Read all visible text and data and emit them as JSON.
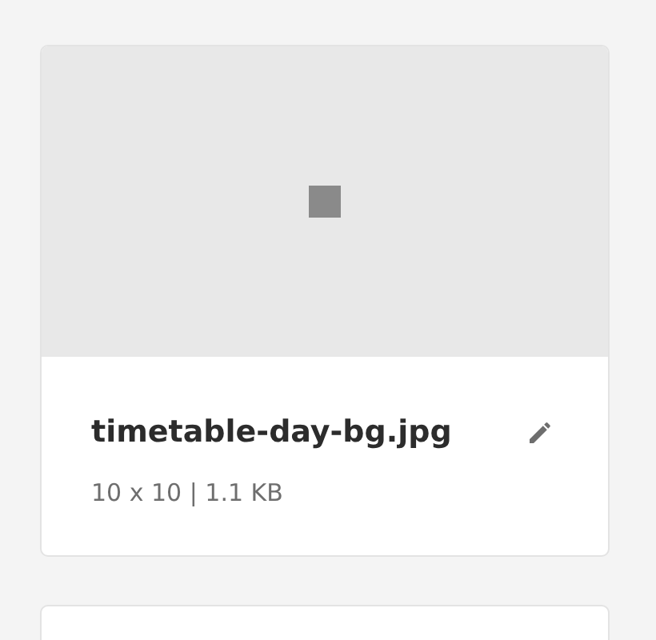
{
  "assets": [
    {
      "kind": "image",
      "name": "timetable-day-bg.jpg",
      "meta": "10 x 10 | 1.1 KB",
      "editable": true
    },
    {
      "kind": "partial"
    }
  ]
}
